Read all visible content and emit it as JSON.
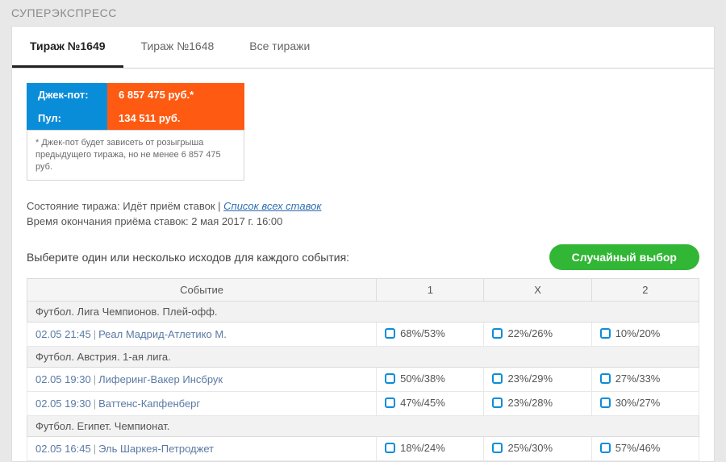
{
  "page_title": "СУПЕРЭКСПРЕСС",
  "tabs": [
    {
      "label": "Тираж №1649",
      "active": true
    },
    {
      "label": "Тираж №1648",
      "active": false
    },
    {
      "label": "Все тиражи",
      "active": false
    }
  ],
  "jackpot": {
    "label": "Джек-пот:",
    "value": "6 857 475 руб.*"
  },
  "pool": {
    "label": "Пул:",
    "value": "134 511 руб."
  },
  "note": "* Джек-пот будет зависеть от розыгрыша предыдущего тиража, но не менее 6 857 475 руб.",
  "status_line1_pre": "Состояние тиража: Идёт приём ставок | ",
  "status_link": "Список всех ставок",
  "status_line2": "Время окончания приёма ставок: 2 мая 2017 г. 16:00",
  "prompt": "Выберите один или несколько исходов для каждого события:",
  "random_btn": "Случайный выбор",
  "headers": {
    "event": "Событие",
    "o1": "1",
    "ox": "X",
    "o2": "2"
  },
  "groups": [
    {
      "title": "Футбол. Лига Чемпионов. Плей-офф.",
      "rows": [
        {
          "dt": "02.05 21:45",
          "match": "Реал Мадрид-Атлетико М.",
          "o1": "68%/53%",
          "ox": "22%/26%",
          "o2": "10%/20%"
        }
      ]
    },
    {
      "title": "Футбол. Австрия. 1-ая лига.",
      "rows": [
        {
          "dt": "02.05 19:30",
          "match": "Лиферинг-Вакер Инсбрук",
          "o1": "50%/38%",
          "ox": "23%/29%",
          "o2": "27%/33%"
        },
        {
          "dt": "02.05 19:30",
          "match": "Ваттенс-Капфенберг",
          "o1": "47%/45%",
          "ox": "23%/28%",
          "o2": "30%/27%"
        }
      ]
    },
    {
      "title": "Футбол. Египет. Чемпионат.",
      "rows": [
        {
          "dt": "02.05 16:45",
          "match": "Эль Шаркея-Петроджет",
          "o1": "18%/24%",
          "ox": "25%/30%",
          "o2": "57%/46%"
        }
      ]
    }
  ]
}
